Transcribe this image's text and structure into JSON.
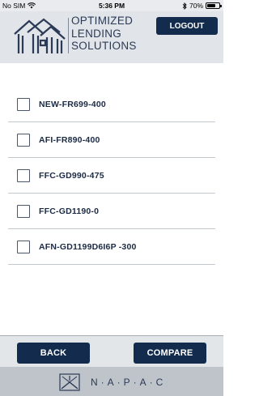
{
  "status_bar": {
    "carrier": "No SIM",
    "time": "5:36 PM",
    "battery": "70%",
    "battery_level": 0.7
  },
  "header": {
    "logo_lines": [
      "OPTIMIZED",
      "LENDING",
      "SOLUTIONS"
    ],
    "logout_label": "LOGOUT"
  },
  "items": [
    {
      "label": "NEW-FR699-400",
      "checked": false
    },
    {
      "label": "AFI-FR890-400",
      "checked": false
    },
    {
      "label": "FFC-GD990-475",
      "checked": false
    },
    {
      "label": "FFC-GD1190-0",
      "checked": false
    },
    {
      "label": "AFN-GD1199D6I6P -300",
      "checked": false
    }
  ],
  "footer": {
    "back_label": "BACK",
    "compare_label": "COMPARE",
    "brand": "N·A·P·A·C"
  },
  "colors": {
    "primary": "#132c4e",
    "header_bg": "#e1e4e8",
    "footer_band": "#bfc4ca"
  }
}
